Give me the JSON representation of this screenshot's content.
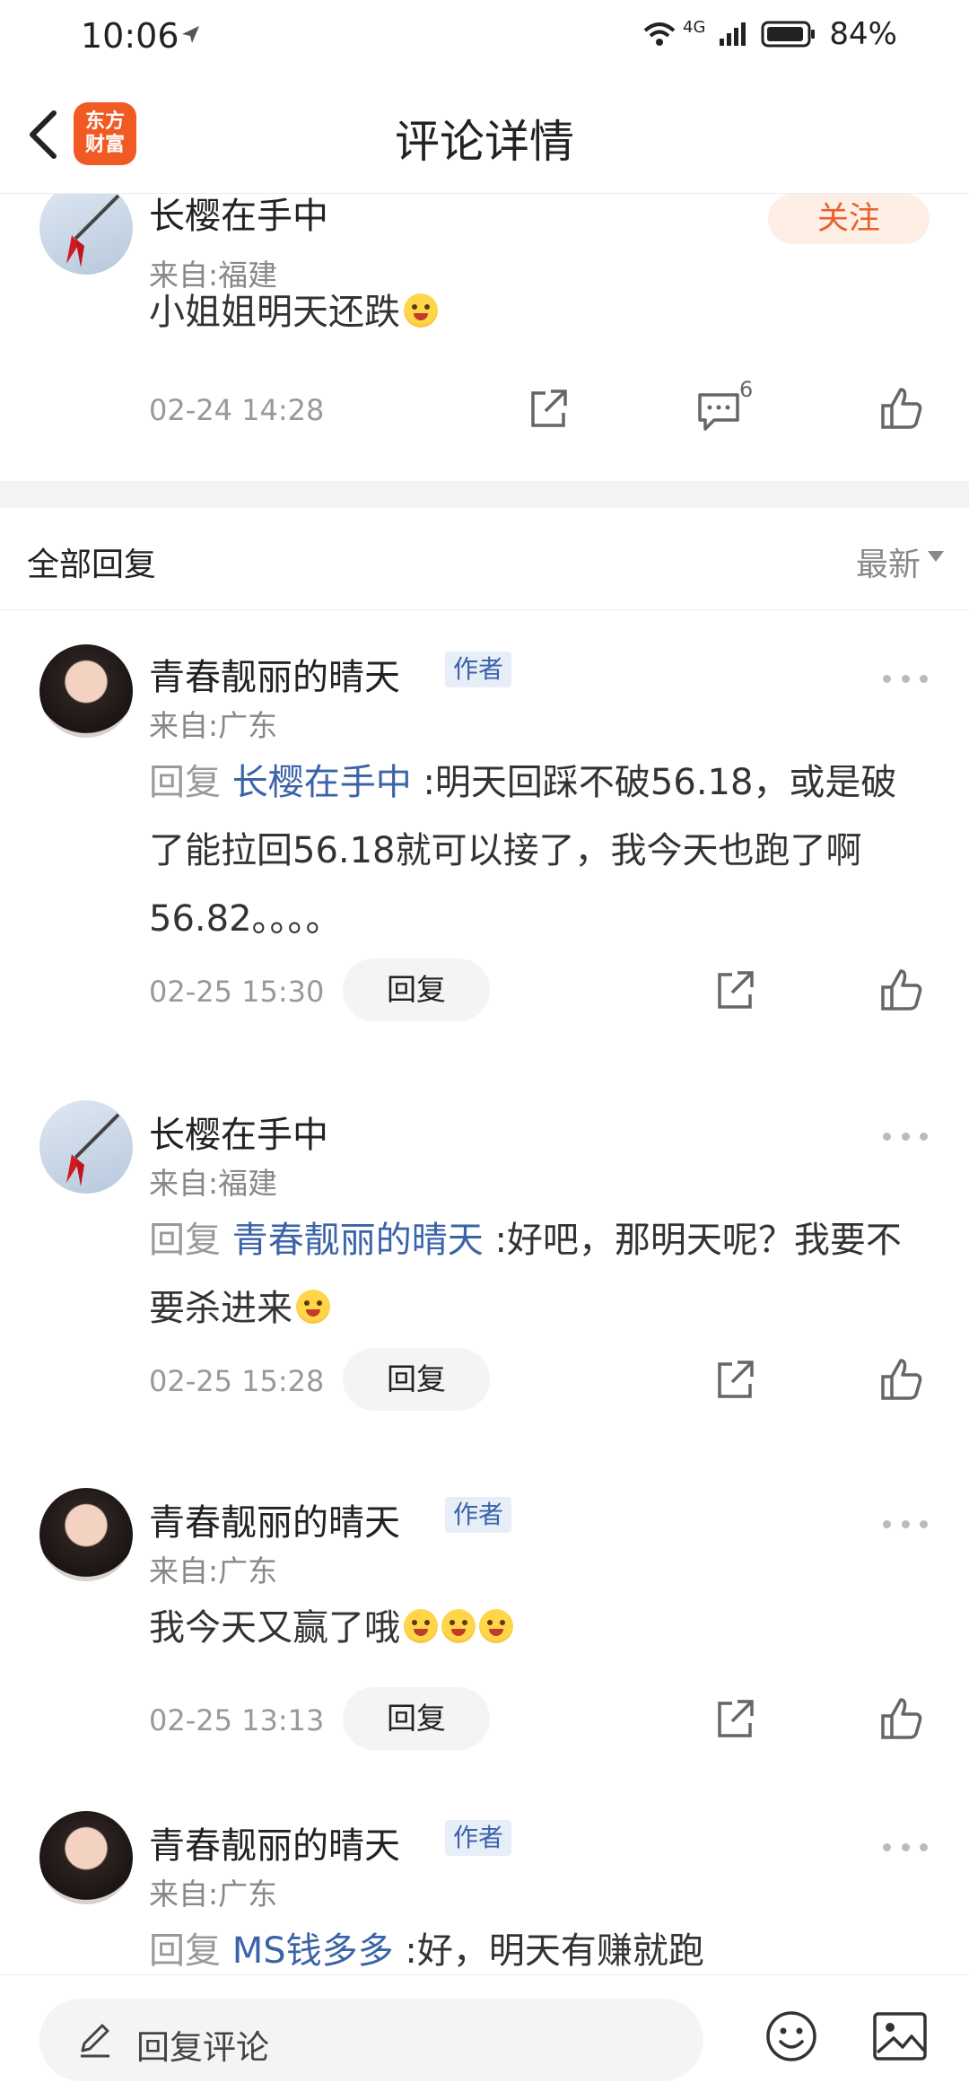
{
  "status_bar": {
    "time": "10:06",
    "network": "4G",
    "battery": "84%"
  },
  "nav": {
    "title": "评论详情",
    "logo_line1": "东方",
    "logo_line2": "财富"
  },
  "top_comment": {
    "author": "长樱在手中",
    "location": "来自:福建",
    "text": "小姐姐明天还跌",
    "emoji": "grinning-emoji",
    "time": "02-24 14:28",
    "comment_count": "6",
    "follow_label": "关注"
  },
  "replies_header": {
    "title": "全部回复",
    "sort": "最新"
  },
  "replies": [
    {
      "author": "青春靓丽的晴天",
      "badge": "作者",
      "location": "来自:广东",
      "prefix": "回复",
      "mention": "长樱在手中",
      "separator": ":",
      "text": "明天回踩不破56.18，或是破了能拉回56.18就可以接了，我今天也跑了啊56.82。。。。",
      "time": "02-25 15:30",
      "reply_label": "回复"
    },
    {
      "author": "长樱在手中",
      "location": "来自:福建",
      "prefix": "回复",
      "mention": "青春靓丽的晴天",
      "separator": ":",
      "text": "好吧，那明天呢？我要不要杀进来",
      "time": "02-25 15:28",
      "reply_label": "回复"
    },
    {
      "author": "青春靓丽的晴天",
      "badge": "作者",
      "location": "来自:广东",
      "text": "我今天又赢了哦",
      "time": "02-25 13:13",
      "reply_label": "回复"
    },
    {
      "author": "青春靓丽的晴天",
      "badge": "作者",
      "location": "来自:广东",
      "prefix": "回复",
      "mention": "MS钱多多",
      "separator": ":",
      "text": "好，明天有赚就跑"
    }
  ],
  "bottom_bar": {
    "placeholder": "回复评论"
  }
}
